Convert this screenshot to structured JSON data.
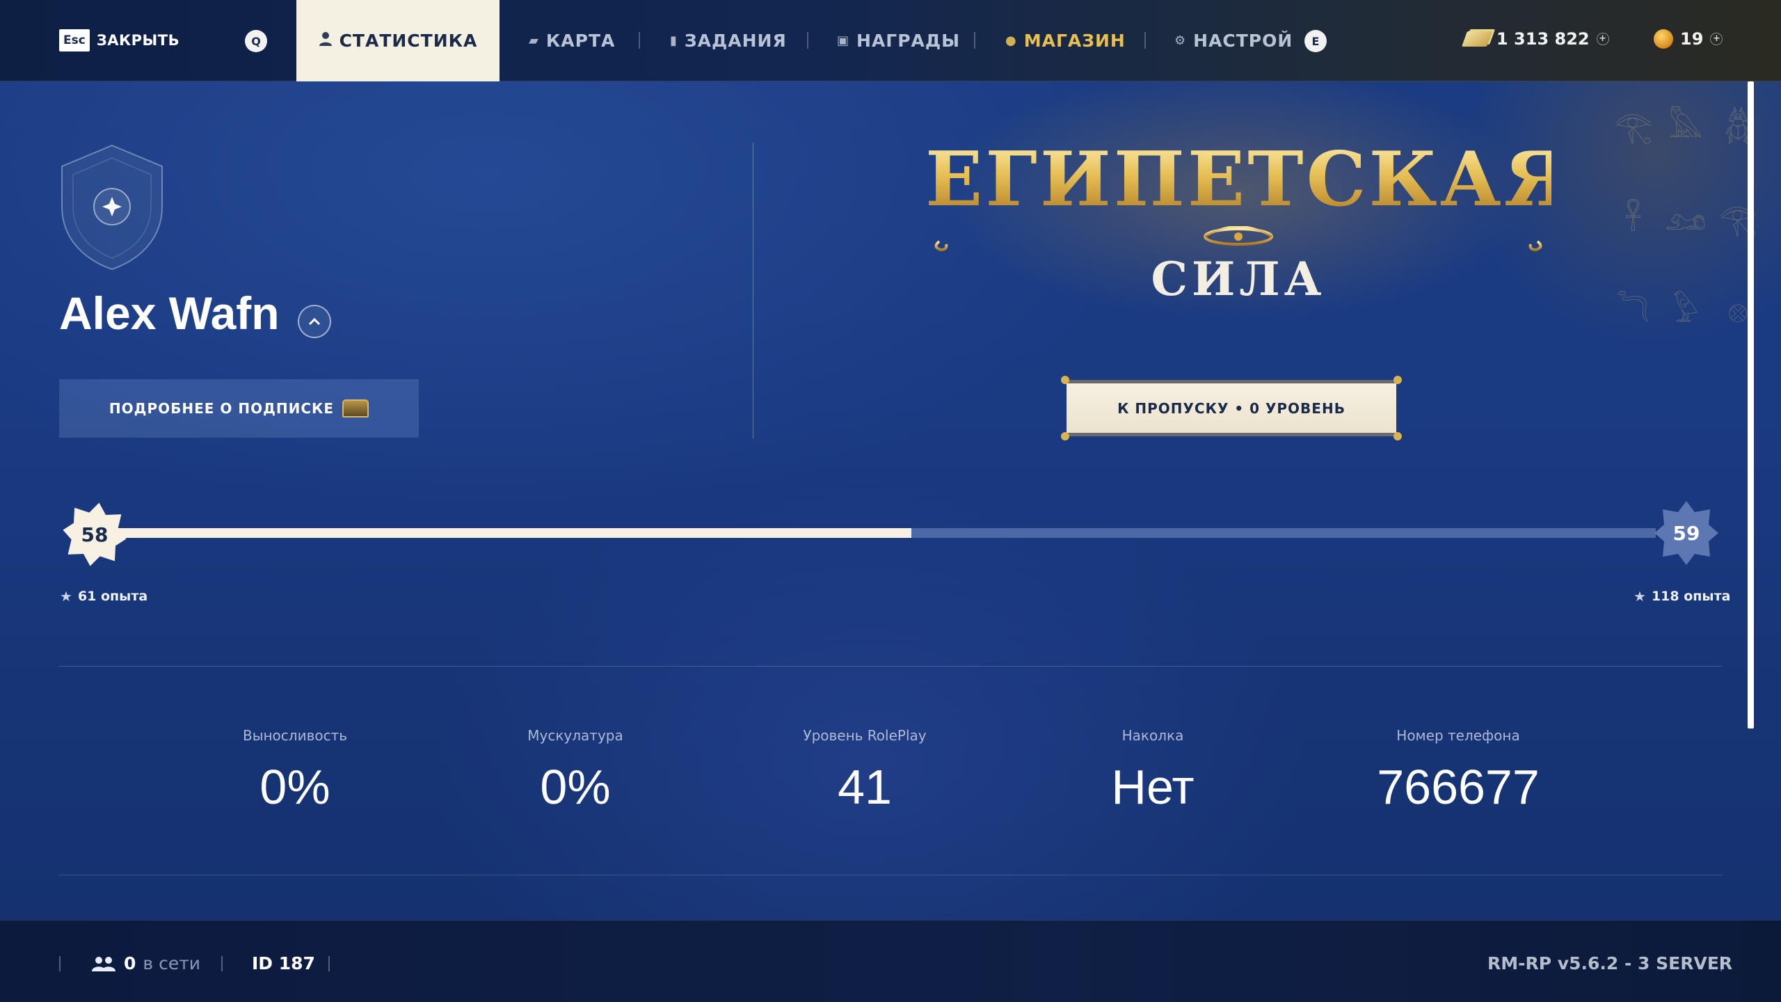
{
  "topbar": {
    "close": {
      "key": "Esc",
      "label": "ЗАКРЫТЬ"
    },
    "prev_key": "Q",
    "next_key": "E",
    "tabs": [
      {
        "label": "СТАТИСТИКА",
        "icon": "person-icon",
        "active": true
      },
      {
        "label": "КАРТА",
        "icon": "map-icon"
      },
      {
        "label": "ЗАДАНИЯ",
        "icon": "note-icon"
      },
      {
        "label": "НАГРАДЫ",
        "icon": "gift-icon"
      },
      {
        "label": "МАГАЗИН",
        "icon": "shop-icon",
        "highlight": "#e6bf55"
      },
      {
        "label": "НАСТРОЙ",
        "icon": "gear-icon"
      }
    ],
    "cash": "1 313 822",
    "coins": "19"
  },
  "profile": {
    "name": "Alex Wafn",
    "subscription_button": "ПОДРОБНЕЕ О ПОДПИСКЕ"
  },
  "event": {
    "title": "ЕГИПЕТСКАЯ",
    "subtitle": "СИЛА",
    "pass_button": "К ПРОПУСКУ • 0 УРОВЕНЬ"
  },
  "level": {
    "current": "58",
    "next": "59",
    "current_xp": "61 опыта",
    "next_xp": "118 опыта",
    "progress": 0.52
  },
  "stats": [
    {
      "label": "Выносливость",
      "value": "0%"
    },
    {
      "label": "Мускулатура",
      "value": "0%"
    },
    {
      "label": "Уровень RolePlay",
      "value": "41"
    },
    {
      "label": "Наколка",
      "value": "Нет"
    },
    {
      "label": "Номер телефона",
      "value": "766677"
    }
  ],
  "footer": {
    "online_count": "0",
    "online_label": "в сети",
    "player_id": "ID 187",
    "version": "RM-RP v5.6.2 - 3 SERVER"
  },
  "colors": {
    "accent_gold": "#e6bf55",
    "active_tab_bg": "#f4f0e2",
    "background_blue": "#1a3a82"
  }
}
